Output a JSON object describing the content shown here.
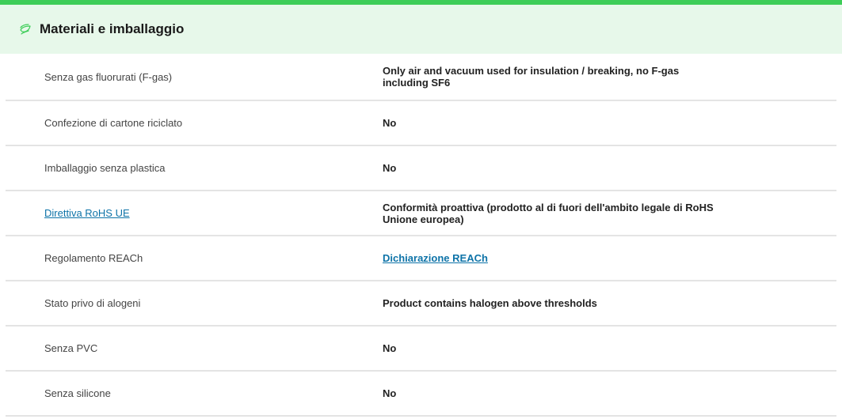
{
  "section": {
    "title": "Materiali e imballaggio",
    "icon": "leaf-icon",
    "accent": "#3dcd58",
    "header_bg": "#e7f8ea",
    "link_color": "#0d73a8"
  },
  "rows": [
    {
      "label": "Senza gas fluorurati (F-gas)",
      "value": "Only air and vacuum used for insulation / breaking, no F-gas including SF6"
    },
    {
      "label": "Confezione di cartone riciclato",
      "value": "No"
    },
    {
      "label": "Imballaggio senza plastica",
      "value": "No"
    },
    {
      "label": "Direttiva RoHS UE",
      "value": "Conformità proattiva (prodotto al di fuori dell'ambito legale di RoHS Unione europea)"
    },
    {
      "label": "Regolamento REACh",
      "value": "Dichiarazione REACh"
    },
    {
      "label": "Stato privo di alogeni",
      "value": "Product contains halogen above thresholds"
    },
    {
      "label": "Senza PVC",
      "value": "No"
    },
    {
      "label": "Senza silicone",
      "value": "No"
    }
  ]
}
